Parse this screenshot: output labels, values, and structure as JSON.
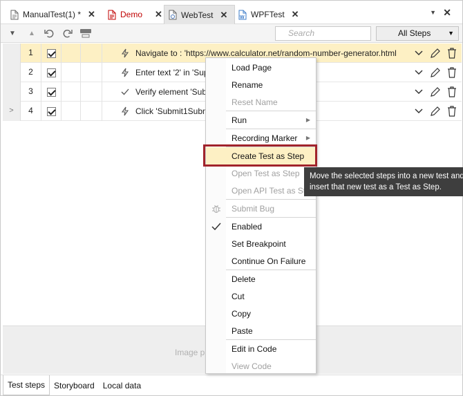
{
  "tabs": [
    {
      "label": "ManualTest(1) *",
      "icon": "manual-test-file-icon",
      "color": "#222222"
    },
    {
      "label": "Demo",
      "icon": "demo-test-file-icon",
      "color": "#c00000"
    },
    {
      "label": "WebTest",
      "icon": "web-test-file-icon",
      "color": "#222222",
      "active": true
    },
    {
      "label": "WPFTest",
      "icon": "wpf-test-file-icon",
      "color": "#222222"
    }
  ],
  "toolbar": {
    "search_placeholder": "Search",
    "filter_value": "All Steps"
  },
  "steps": [
    {
      "num": "1",
      "icon": "lightning-icon",
      "text": "Navigate to : 'https://www.calculator.net/random-number-generator.html",
      "selected": true
    },
    {
      "num": "2",
      "icon": "lightning-icon",
      "text": "Enter text '2' in 'Sup"
    },
    {
      "num": "3",
      "icon": "check-icon",
      "text": "Verify element 'Subm"
    },
    {
      "num": "4",
      "icon": "lightning-icon",
      "text": "Click 'Submit1Subm",
      "gutter": ">"
    }
  ],
  "bottom_area_text": "Image pr",
  "bottom_tabs": [
    "Test steps",
    "Storyboard",
    "Local data"
  ],
  "context_menu": [
    {
      "label": "Load Page"
    },
    {
      "label": "Rename"
    },
    {
      "label": "Reset Name",
      "disabled": true
    },
    {
      "sep": true
    },
    {
      "label": "Run",
      "submenu": true
    },
    {
      "sep": true
    },
    {
      "label": "Recording Marker",
      "submenu": true
    },
    {
      "sep": true
    },
    {
      "label": "Create Test as Step",
      "highlighted": true
    },
    {
      "label": "Open Test as Step",
      "disabled": true
    },
    {
      "label": "Open API Test as Step",
      "disabled": true
    },
    {
      "sep": true
    },
    {
      "label": "Submit Bug",
      "disabled": true,
      "icon": "bug-icon"
    },
    {
      "sep": true
    },
    {
      "label": "Enabled",
      "icon": "checkmark-icon"
    },
    {
      "label": "Set Breakpoint"
    },
    {
      "label": "Continue On Failure"
    },
    {
      "sep": true
    },
    {
      "label": "Delete"
    },
    {
      "label": "Cut"
    },
    {
      "label": "Copy"
    },
    {
      "label": "Paste"
    },
    {
      "sep": true
    },
    {
      "label": "Edit in Code"
    },
    {
      "label": "View Code",
      "disabled": true
    }
  ],
  "tooltip": {
    "line1": "Move the selected steps into a new test and",
    "line2": "insert that new test as a Test as Step."
  },
  "colors": {
    "selected_row": "#fdf0c4",
    "highlight_border": "#a1232b",
    "demo_tab": "#c00000",
    "tooltip_bg": "#3e3e3e"
  }
}
